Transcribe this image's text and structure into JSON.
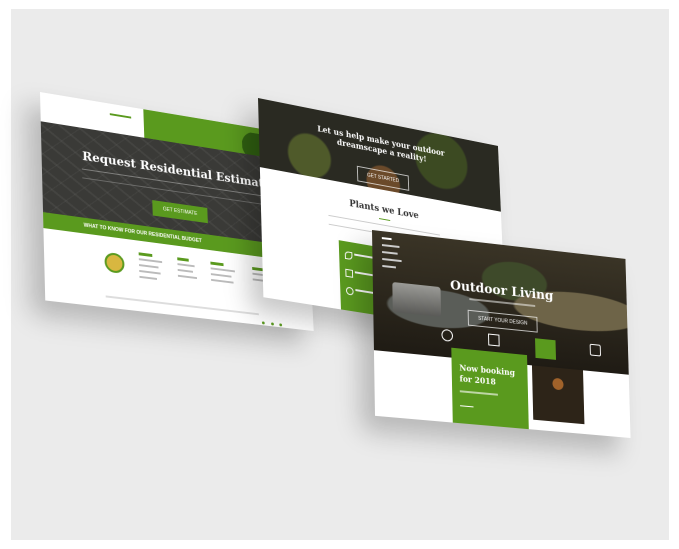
{
  "colors": {
    "accent_green": "#5a9a1e",
    "dark_overlay": "#2c2c2a",
    "background": "#ebebeb"
  },
  "left_page": {
    "logo_top": "",
    "hero_small": "",
    "hero_title": "Request Residential Estimate",
    "hero_sub": "",
    "cta": "GET ESTIMATE",
    "bar_text": "WHAT TO KNOW FOR OUR RESIDENTIAL BUDGET",
    "bar_link": "",
    "footer_cols": [
      {
        "title": "",
        "items": [
          "",
          "",
          "",
          ""
        ]
      },
      {
        "title": "",
        "items": [
          "",
          "",
          ""
        ]
      },
      {
        "title": "",
        "items": [
          "",
          "",
          "",
          ""
        ]
      },
      {
        "title": "",
        "items": [
          "",
          "",
          ""
        ]
      }
    ]
  },
  "mid_page": {
    "hero_title": "Let us help make your outdoor dreamscape a reality!",
    "hero_button": "GET STARTED",
    "section_title": "Plants we Love"
  },
  "front_page": {
    "hero_title": "Outdoor Living",
    "hero_button": "START YOUR DESIGN",
    "booking_title": "Now booking for 2018",
    "booking_link": ""
  }
}
